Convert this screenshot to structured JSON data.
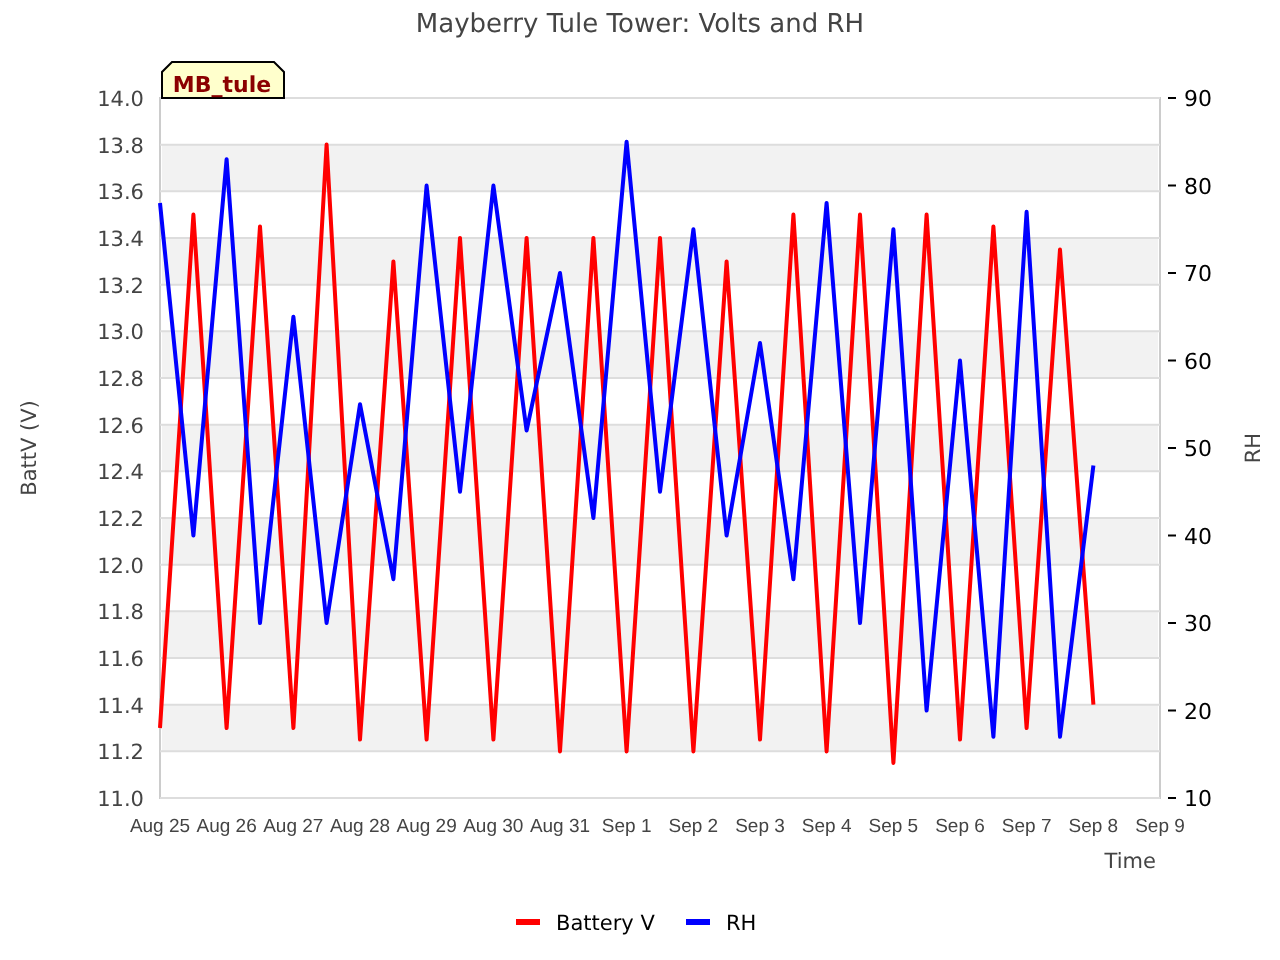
{
  "station_badge": "MB_tule",
  "chart_data": {
    "type": "line",
    "title": "Mayberry Tule Tower: Volts and RH",
    "xlabel": "Time",
    "ylabel": "BattV (V)",
    "y2label": "RH",
    "grid": true,
    "legend": true,
    "categories": [
      "Aug 25",
      null,
      "Aug 26",
      null,
      "Aug 27",
      null,
      "Aug 28",
      null,
      "Aug 29",
      null,
      "Aug 30",
      null,
      "Aug 31",
      null,
      "Sep 1",
      null,
      "Sep 2",
      null,
      "Sep 3",
      null,
      "Sep 4",
      null,
      "Sep 5",
      null,
      "Sep 6",
      null,
      "Sep 7",
      null,
      "Sep 8",
      null,
      "Sep 9"
    ],
    "ylim": [
      11.0,
      14.0
    ],
    "yticks": [
      {
        "value": 11.0,
        "label": "11.0"
      },
      {
        "value": 11.2,
        "label": "11.2"
      },
      {
        "value": 11.4,
        "label": "11.4"
      },
      {
        "value": 11.6,
        "label": "11.6"
      },
      {
        "value": 11.8,
        "label": "11.8"
      },
      {
        "value": 12.0,
        "label": "12.0"
      },
      {
        "value": 12.2,
        "label": "12.2"
      },
      {
        "value": 12.4,
        "label": "12.4"
      },
      {
        "value": 12.6,
        "label": "12.6"
      },
      {
        "value": 12.8,
        "label": "12.8"
      },
      {
        "value": 13.0,
        "label": "13.0"
      },
      {
        "value": 13.2,
        "label": "13.2"
      },
      {
        "value": 13.4,
        "label": "13.4"
      },
      {
        "value": 13.6,
        "label": "13.6"
      },
      {
        "value": 13.8,
        "label": "13.8"
      },
      {
        "value": 14.0,
        "label": "14.0"
      }
    ],
    "y2lim": [
      10,
      90
    ],
    "y2ticks": [
      {
        "value": 10,
        "label": "10"
      },
      {
        "value": 20,
        "label": "20"
      },
      {
        "value": 30,
        "label": "30"
      },
      {
        "value": 40,
        "label": "40"
      },
      {
        "value": 50,
        "label": "50"
      },
      {
        "value": 60,
        "label": "60"
      },
      {
        "value": 70,
        "label": "70"
      },
      {
        "value": 80,
        "label": "80"
      },
      {
        "value": 90,
        "label": "90"
      }
    ],
    "series": [
      {
        "name": "Battery V",
        "color": "#ff0000",
        "values": [
          11.3,
          13.5,
          11.3,
          13.45,
          11.3,
          13.8,
          11.25,
          13.3,
          11.25,
          13.4,
          11.25,
          13.4,
          11.2,
          13.4,
          11.2,
          13.4,
          11.2,
          13.3,
          11.25,
          13.5,
          11.2,
          13.5,
          11.15,
          13.5,
          11.25,
          13.45,
          11.3,
          13.35,
          11.4,
          null,
          null
        ]
      },
      {
        "name": "RH",
        "color": "#0000ff",
        "axis": "y2",
        "values": [
          78,
          40,
          83,
          30,
          65,
          30,
          55,
          35,
          80,
          45,
          80,
          52,
          70,
          42,
          85,
          45,
          75,
          40,
          62,
          35,
          78,
          30,
          75,
          20,
          60,
          17,
          77,
          17,
          48,
          null,
          null
        ]
      }
    ]
  }
}
